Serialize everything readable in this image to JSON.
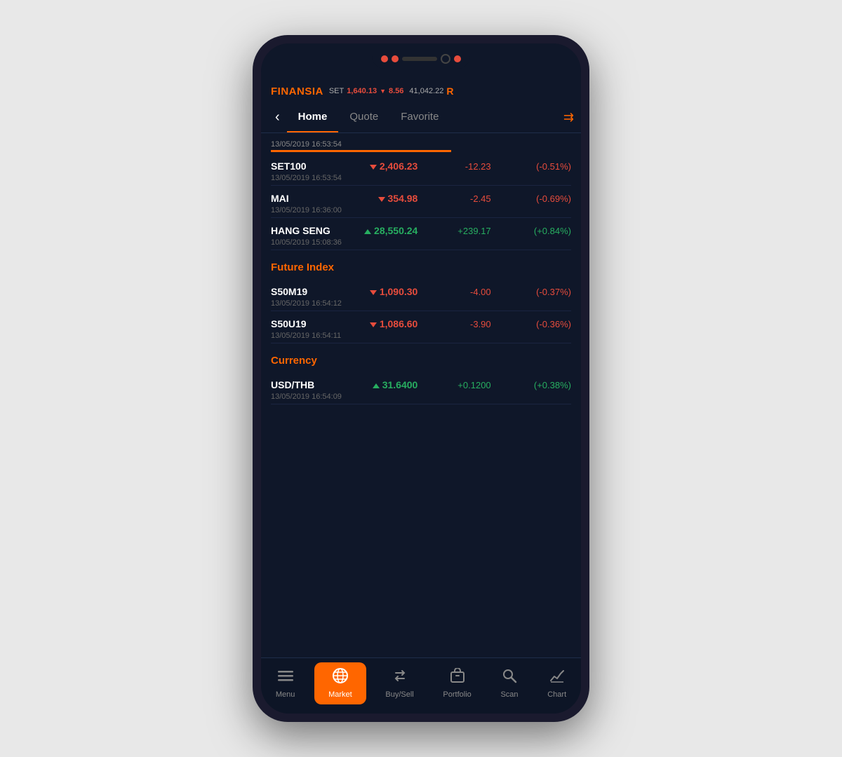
{
  "app": {
    "logo_prefix": "F",
    "logo_text": "INANSIA"
  },
  "status_bar": {
    "set_label": "SET",
    "set_value": "1,640.13",
    "set_arrow": "▼",
    "set_change": "8.56",
    "index_value": "41,042.22",
    "r_badge": "R"
  },
  "tabs": [
    {
      "label": "Home",
      "active": true
    },
    {
      "label": "Quote",
      "active": false
    },
    {
      "label": "Favorite",
      "active": false
    }
  ],
  "indices": [
    {
      "name": "SET100",
      "direction": "down",
      "price": "2,406.23",
      "change": "-12.23",
      "pct": "(-0.51%)",
      "time": "13/05/2019  16:53:54",
      "price_color": "red",
      "change_color": "red",
      "pct_color": "red"
    },
    {
      "name": "MAI",
      "direction": "down",
      "price": "354.98",
      "change": "-2.45",
      "pct": "(-0.69%)",
      "time": "13/05/2019  16:36:00",
      "price_color": "red",
      "change_color": "red",
      "pct_color": "red"
    },
    {
      "name": "HANG SENG",
      "direction": "up",
      "price": "28,550.24",
      "change": "+239.17",
      "pct": "(+0.84%)",
      "time": "10/05/2019  15:08:36",
      "price_color": "green",
      "change_color": "green",
      "pct_color": "green"
    }
  ],
  "future_section": {
    "label": "Future Index"
  },
  "futures": [
    {
      "name": "S50M19",
      "direction": "down",
      "price": "1,090.30",
      "change": "-4.00",
      "pct": "(-0.37%)",
      "time": "13/05/2019  16:54:12",
      "price_color": "red",
      "change_color": "red",
      "pct_color": "red"
    },
    {
      "name": "S50U19",
      "direction": "down",
      "price": "1,086.60",
      "change": "-3.90",
      "pct": "(-0.36%)",
      "time": "13/05/2019  16:54:11",
      "price_color": "red",
      "change_color": "red",
      "pct_color": "red"
    }
  ],
  "currency_section": {
    "label": "Currency"
  },
  "currencies": [
    {
      "name": "USD/THB",
      "direction": "up",
      "price": "31.6400",
      "change": "+0.1200",
      "pct": "(+0.38%)",
      "time": "13/05/2019  16:54:09",
      "price_color": "green",
      "change_color": "green",
      "pct_color": "green"
    }
  ],
  "bottom_nav": [
    {
      "icon": "☰",
      "label": "Menu",
      "active": false
    },
    {
      "icon": "🌐",
      "label": "Market",
      "active": true
    },
    {
      "icon": "⇄",
      "label": "Buy/Sell",
      "active": false
    },
    {
      "icon": "▣",
      "label": "Portfolio",
      "active": false
    },
    {
      "icon": "🔍",
      "label": "Scan",
      "active": false
    },
    {
      "icon": "📈",
      "label": "Chart",
      "active": false
    }
  ]
}
